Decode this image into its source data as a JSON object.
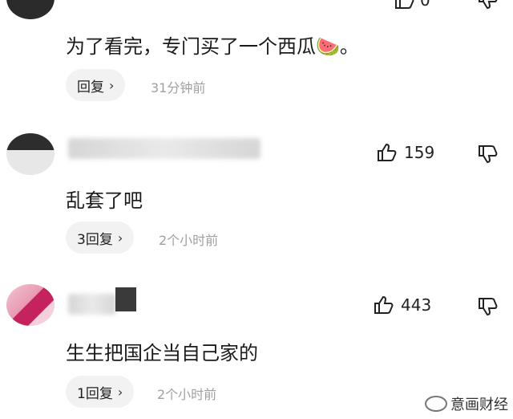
{
  "comments": [
    {
      "text": "为了看完，专门买了一个西瓜",
      "emoji": "🍉",
      "text_end": "。",
      "like_count": "0",
      "reply_label": "回复",
      "time": "31分钟前"
    },
    {
      "text": "乱套了吧",
      "like_count": "159",
      "reply_label": "3回复",
      "time": "2个小时前"
    },
    {
      "text": "生生把国企当自己家的",
      "like_count": "443",
      "reply_label": "1回复",
      "time": "2个小时前"
    }
  ],
  "icons": {
    "like": "thumbs-up-icon",
    "dislike": "thumbs-down-icon",
    "chevron": "chevron-right-icon"
  },
  "watermark": {
    "text": "意画财经"
  }
}
